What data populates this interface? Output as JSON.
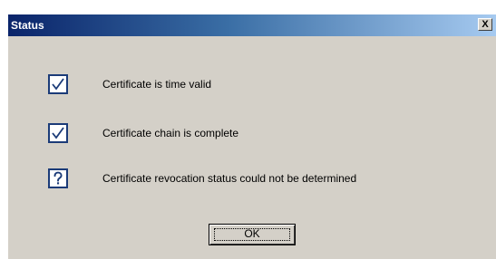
{
  "window": {
    "title": "Status",
    "close_label": "X"
  },
  "status_items": [
    {
      "icon": "checkmark-icon",
      "text": "Certificate is time valid"
    },
    {
      "icon": "checkmark-icon",
      "text": "Certificate chain is complete"
    },
    {
      "icon": "question-mark-icon",
      "text": "Certificate revocation status could not be determined"
    }
  ],
  "buttons": {
    "ok_label": "OK"
  },
  "colors": {
    "dialog_bg": "#d4d0c8",
    "titlebar_start": "#0a246a",
    "titlebar_end": "#a6caf0",
    "icon_border": "#1b3b78"
  }
}
